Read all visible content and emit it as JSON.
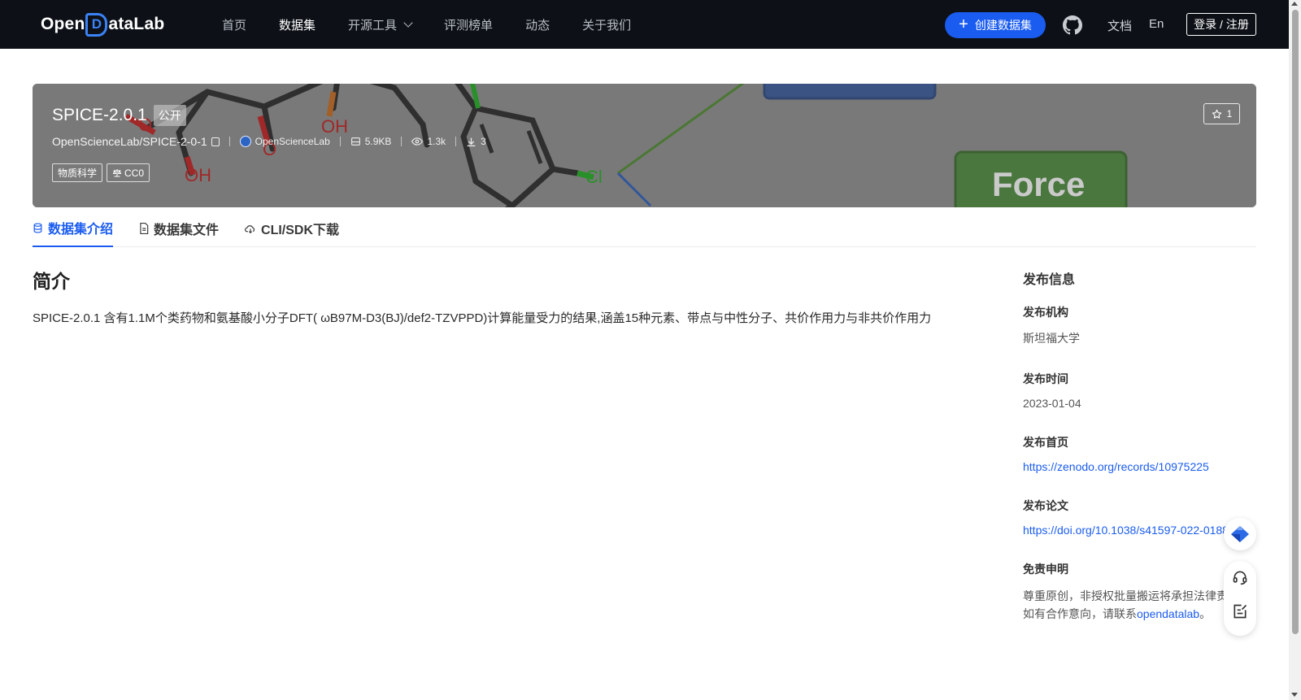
{
  "nav": {
    "logo_left": "Open",
    "logo_d": "D",
    "logo_right": "ataLab",
    "items": [
      {
        "label": "首页"
      },
      {
        "label": "数据集"
      },
      {
        "label": "开源工具"
      },
      {
        "label": "评测榜单"
      },
      {
        "label": "动态"
      },
      {
        "label": "关于我们"
      }
    ],
    "create_label": "创建数据集",
    "docs_label": "文档",
    "lang_label": "En",
    "login_label": "登录 / 注册"
  },
  "dataset": {
    "name": "SPICE-2.0.1",
    "visibility": "公开",
    "star_count": "1",
    "repo_path": "OpenScienceLab/SPICE-2-0-1",
    "org": "OpenScienceLab",
    "size": "5.9KB",
    "views": "1.3k",
    "downloads": "3",
    "tags": [
      "物质科学",
      "CC0"
    ]
  },
  "banner_image": {
    "labels": [
      "OH",
      "O",
      "OH",
      "O",
      "Cl",
      "Force"
    ]
  },
  "tabs": [
    {
      "label": "数据集介绍"
    },
    {
      "label": "数据集文件"
    },
    {
      "label": "CLI/SDK下载"
    }
  ],
  "intro": {
    "heading": "简介",
    "body": "SPICE-2.0.1 含有1.1M个类药物和氨基酸小分子DFT( ωB97M-D3(BJ)/def2-TZVPPD)计算能量受力的结果,涵盖15种元素、带点与中性分子、共价作用力与非共价作用力"
  },
  "sidebar": {
    "title": "发布信息",
    "org_label": "发布机构",
    "org_value": "斯坦福大学",
    "date_label": "发布时间",
    "date_value": "2023-01-04",
    "home_label": "发布首页",
    "home_value": "https://zenodo.org/records/10975225",
    "paper_label": "发布论文",
    "paper_value": "https://doi.org/10.1038/s41597-022-01882-6",
    "disclaimer_label": "免责申明",
    "disclaimer_line1": "尊重原创，非授权批量搬运将承担法律责",
    "disclaimer_line2_prefix": "如有合作意向，请联系",
    "disclaimer_link": "opendatalab",
    "disclaimer_line2_suffix": "。"
  },
  "colors": {
    "nav_bg": "#0d1117",
    "accent": "#1a5cf0",
    "banner_bg": "#7b7b7b"
  }
}
